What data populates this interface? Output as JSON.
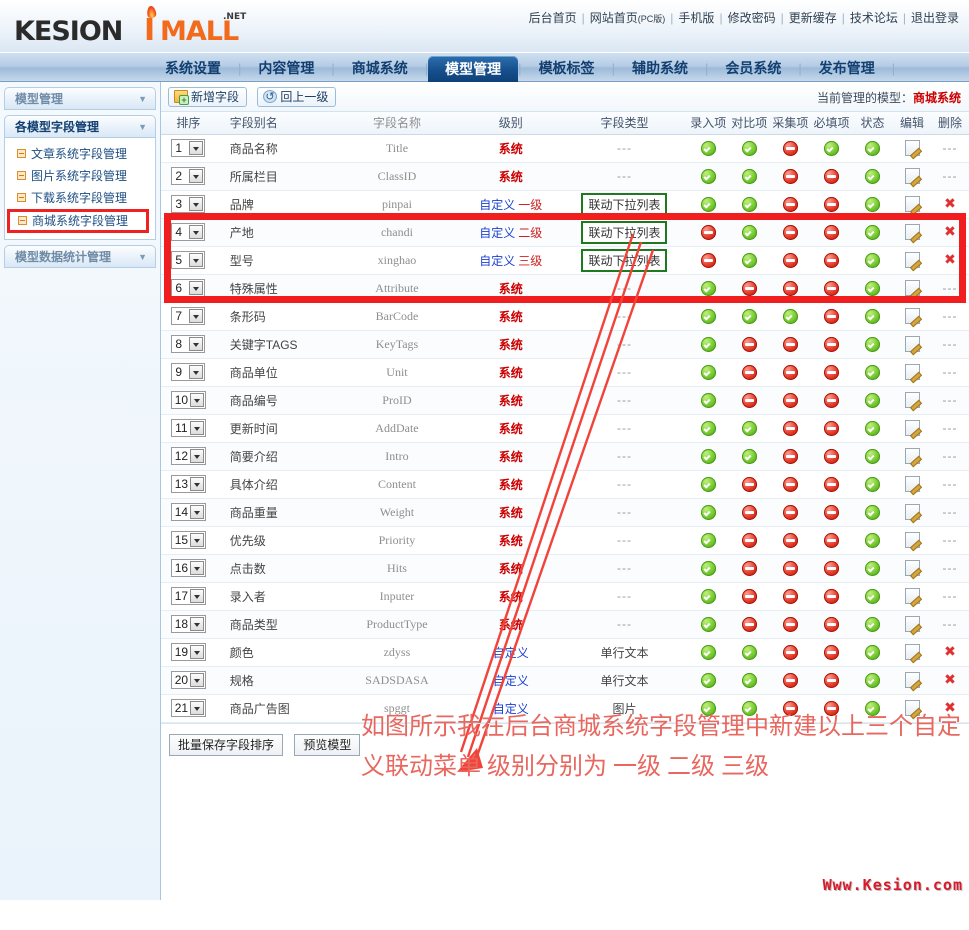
{
  "header": {
    "logo": {
      "kesion": "KESION",
      "i": "I",
      "mall": "MALL",
      "net": ".NET",
      "reflect": "KESION IMALL"
    },
    "top_links": [
      {
        "label": "后台首页"
      },
      {
        "label": "网站首页",
        "suffix": "(PC版)"
      },
      {
        "label": "手机版"
      },
      {
        "label": "修改密码"
      },
      {
        "label": "更新缓存"
      },
      {
        "label": "技术论坛"
      },
      {
        "label": "退出登录"
      }
    ]
  },
  "nav": {
    "items": [
      {
        "label": "系统设置",
        "active": false
      },
      {
        "label": "内容管理",
        "active": false
      },
      {
        "label": "商城系统",
        "active": false
      },
      {
        "label": "模型管理",
        "active": true
      },
      {
        "label": "模板标签",
        "active": false
      },
      {
        "label": "辅助系统",
        "active": false
      },
      {
        "label": "会员系统",
        "active": false
      },
      {
        "label": "发布管理",
        "active": false
      }
    ]
  },
  "sidebar": {
    "panels": [
      {
        "title": "模型管理",
        "current": false,
        "items": []
      },
      {
        "title": "各模型字段管理",
        "current": true,
        "items": [
          {
            "label": "文章系统字段管理",
            "highlight": false
          },
          {
            "label": "图片系统字段管理",
            "highlight": false
          },
          {
            "label": "下载系统字段管理",
            "highlight": false
          },
          {
            "label": "商城系统字段管理",
            "highlight": true
          }
        ]
      },
      {
        "title": "模型数据统计管理",
        "current": false,
        "items": []
      }
    ]
  },
  "toolbar": {
    "add_field_label": "新增字段",
    "back_label": "回上一级",
    "model_info_prefix": "当前管理的模型：",
    "model_info_value": "商城系统"
  },
  "table": {
    "headers": [
      "排序",
      "字段别名",
      "字段名称",
      "级别",
      "字段类型",
      "录入项",
      "对比项",
      "采集项",
      "必填项",
      "状态",
      "编辑",
      "删除"
    ],
    "rows": [
      {
        "order": "1",
        "alias": "商品名称",
        "name": "Title",
        "level": "系统",
        "level_kind": "sys",
        "sub": "",
        "type": "---",
        "type_box": false,
        "input": "yes",
        "compare": "yes",
        "collect": "no",
        "required": "yes",
        "status": "yes",
        "del": false,
        "hl": false
      },
      {
        "order": "2",
        "alias": "所属栏目",
        "name": "ClassID",
        "level": "系统",
        "level_kind": "sys",
        "sub": "",
        "type": "---",
        "type_box": false,
        "input": "yes",
        "compare": "yes",
        "collect": "no",
        "required": "no",
        "status": "yes",
        "del": false,
        "hl": false
      },
      {
        "order": "3",
        "alias": "品牌",
        "name": "pinpai",
        "level": "自定义",
        "level_kind": "cus",
        "sub": "一级",
        "type": "联动下拉列表",
        "type_box": true,
        "input": "yes",
        "compare": "yes",
        "collect": "no",
        "required": "no",
        "status": "yes",
        "del": true,
        "hl": true
      },
      {
        "order": "4",
        "alias": "产地",
        "name": "chandi",
        "level": "自定义",
        "level_kind": "cus",
        "sub": "二级",
        "type": "联动下拉列表",
        "type_box": true,
        "input": "no",
        "compare": "yes",
        "collect": "no",
        "required": "no",
        "status": "yes",
        "del": true,
        "hl": true
      },
      {
        "order": "5",
        "alias": "型号",
        "name": "xinghao",
        "level": "自定义",
        "level_kind": "cus",
        "sub": "三级",
        "type": "联动下拉列表",
        "type_box": true,
        "input": "no",
        "compare": "yes",
        "collect": "no",
        "required": "no",
        "status": "yes",
        "del": true,
        "hl": true
      },
      {
        "order": "6",
        "alias": "特殊属性",
        "name": "Attribute",
        "level": "系统",
        "level_kind": "sys",
        "sub": "",
        "type": "---",
        "type_box": false,
        "input": "yes",
        "compare": "no",
        "collect": "no",
        "required": "no",
        "status": "yes",
        "del": false,
        "hl": false
      },
      {
        "order": "7",
        "alias": "条形码",
        "name": "BarCode",
        "level": "系统",
        "level_kind": "sys",
        "sub": "",
        "type": "---",
        "type_box": false,
        "input": "yes",
        "compare": "yes",
        "collect": "yes",
        "required": "no",
        "status": "yes",
        "del": false,
        "hl": false
      },
      {
        "order": "8",
        "alias": "关键字TAGS",
        "name": "KeyTags",
        "level": "系统",
        "level_kind": "sys",
        "sub": "",
        "type": "---",
        "type_box": false,
        "input": "yes",
        "compare": "no",
        "collect": "no",
        "required": "no",
        "status": "yes",
        "del": false,
        "hl": false
      },
      {
        "order": "9",
        "alias": "商品单位",
        "name": "Unit",
        "level": "系统",
        "level_kind": "sys",
        "sub": "",
        "type": "---",
        "type_box": false,
        "input": "yes",
        "compare": "no",
        "collect": "no",
        "required": "no",
        "status": "yes",
        "del": false,
        "hl": false
      },
      {
        "order": "10",
        "alias": "商品编号",
        "name": "ProID",
        "level": "系统",
        "level_kind": "sys",
        "sub": "",
        "type": "---",
        "type_box": false,
        "input": "yes",
        "compare": "no",
        "collect": "no",
        "required": "no",
        "status": "yes",
        "del": false,
        "hl": false
      },
      {
        "order": "11",
        "alias": "更新时间",
        "name": "AddDate",
        "level": "系统",
        "level_kind": "sys",
        "sub": "",
        "type": "---",
        "type_box": false,
        "input": "yes",
        "compare": "yes",
        "collect": "no",
        "required": "no",
        "status": "yes",
        "del": false,
        "hl": false
      },
      {
        "order": "12",
        "alias": "简要介绍",
        "name": "Intro",
        "level": "系统",
        "level_kind": "sys",
        "sub": "",
        "type": "---",
        "type_box": false,
        "input": "yes",
        "compare": "yes",
        "collect": "no",
        "required": "no",
        "status": "yes",
        "del": false,
        "hl": false
      },
      {
        "order": "13",
        "alias": "具体介绍",
        "name": "Content",
        "level": "系统",
        "level_kind": "sys",
        "sub": "",
        "type": "---",
        "type_box": false,
        "input": "yes",
        "compare": "no",
        "collect": "no",
        "required": "no",
        "status": "yes",
        "del": false,
        "hl": false
      },
      {
        "order": "14",
        "alias": "商品重量",
        "name": "Weight",
        "level": "系统",
        "level_kind": "sys",
        "sub": "",
        "type": "---",
        "type_box": false,
        "input": "yes",
        "compare": "no",
        "collect": "no",
        "required": "no",
        "status": "yes",
        "del": false,
        "hl": false
      },
      {
        "order": "15",
        "alias": "优先级",
        "name": "Priority",
        "level": "系统",
        "level_kind": "sys",
        "sub": "",
        "type": "---",
        "type_box": false,
        "input": "yes",
        "compare": "no",
        "collect": "no",
        "required": "no",
        "status": "yes",
        "del": false,
        "hl": false
      },
      {
        "order": "16",
        "alias": "点击数",
        "name": "Hits",
        "level": "系统",
        "level_kind": "sys",
        "sub": "",
        "type": "---",
        "type_box": false,
        "input": "yes",
        "compare": "no",
        "collect": "no",
        "required": "no",
        "status": "yes",
        "del": false,
        "hl": false
      },
      {
        "order": "17",
        "alias": "录入者",
        "name": "Inputer",
        "level": "系统",
        "level_kind": "sys",
        "sub": "",
        "type": "---",
        "type_box": false,
        "input": "yes",
        "compare": "no",
        "collect": "no",
        "required": "no",
        "status": "yes",
        "del": false,
        "hl": false
      },
      {
        "order": "18",
        "alias": "商品类型",
        "name": "ProductType",
        "level": "系统",
        "level_kind": "sys",
        "sub": "",
        "type": "---",
        "type_box": false,
        "input": "yes",
        "compare": "no",
        "collect": "no",
        "required": "no",
        "status": "yes",
        "del": false,
        "hl": false
      },
      {
        "order": "19",
        "alias": "颜色",
        "name": "zdyss",
        "level": "自定义",
        "level_kind": "cus",
        "sub": "",
        "type": "单行文本",
        "type_box": false,
        "input": "yes",
        "compare": "yes",
        "collect": "no",
        "required": "no",
        "status": "yes",
        "del": true,
        "hl": false
      },
      {
        "order": "20",
        "alias": "规格",
        "name": "SADSDASA",
        "level": "自定义",
        "level_kind": "cus",
        "sub": "",
        "type": "单行文本",
        "type_box": false,
        "input": "yes",
        "compare": "yes",
        "collect": "no",
        "required": "no",
        "status": "yes",
        "del": true,
        "hl": false
      },
      {
        "order": "21",
        "alias": "商品广告图",
        "name": "spggt",
        "level": "自定义",
        "level_kind": "cus",
        "sub": "",
        "type": "图片",
        "type_box": false,
        "input": "yes",
        "compare": "yes",
        "collect": "no",
        "required": "no",
        "status": "yes",
        "del": true,
        "hl": false
      }
    ]
  },
  "footer": {
    "save_order_label": "批量保存字段排序",
    "preview_label": "预览模型"
  },
  "annotation": {
    "text": "如图所示我在后台商城系统字段管理中新建以上三个自定义联动菜单 级别分别为 一级 二级 三级",
    "color": "#e8675f"
  },
  "watermark": {
    "text": "Www.Kesion.com",
    "color": "#d81b2a"
  }
}
